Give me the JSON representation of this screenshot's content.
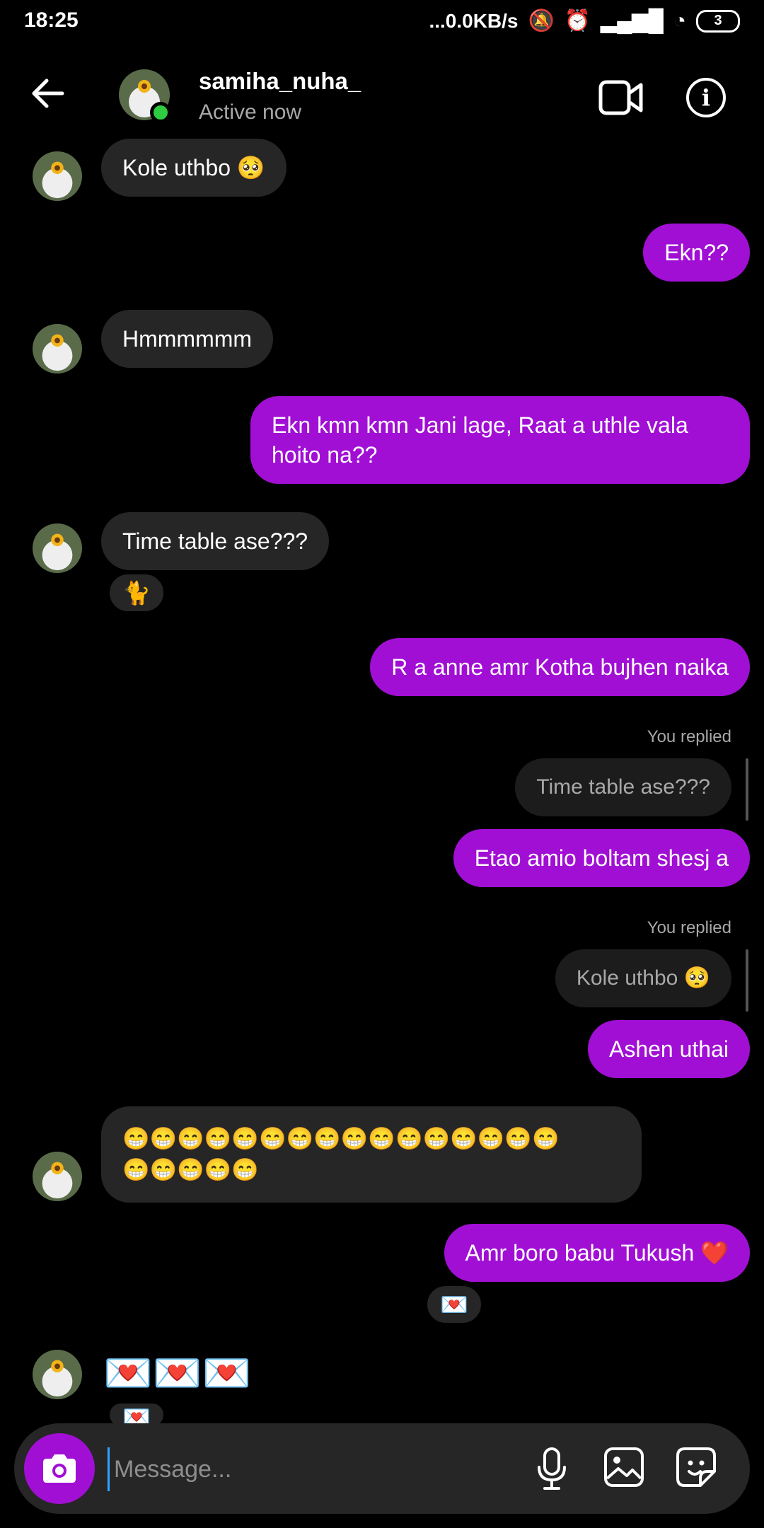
{
  "status_bar": {
    "time": "18:25",
    "network_speed": "...0.0KB/s",
    "battery": "3"
  },
  "header": {
    "username": "samiha_nuha_",
    "status": "Active now"
  },
  "messages": {
    "m1": "Kole uthbo 🥺",
    "m2": "Ekn??",
    "m3": "Hmmmmmm",
    "m4": "Ekn kmn kmn Jani lage, Raat a uthle vala hoito na??",
    "m5": "Time table ase???",
    "m5_reaction": "🐈",
    "m6": "R a anne amr Kotha bujhen naika",
    "reply1_label": "You replied",
    "reply1_quote": "Time table ase???",
    "m7": "Etao amio boltam shesj a",
    "reply2_label": "You replied",
    "reply2_quote": "Kole uthbo 🥺",
    "m8": "Ashen uthai",
    "m9": "😁😁😁😁😁😁😁😁😁😁😁😁😁😁😁😁\n😁😁😁😁😁",
    "m10": "Amr boro babu Tukush ❤️",
    "m10_reaction": "💌",
    "m11": "💌💌💌",
    "m11_reaction": "💌"
  },
  "composer": {
    "placeholder": "Message..."
  },
  "colors": {
    "outgoing_bubble": "#a10fd4",
    "incoming_bubble": "#262626",
    "online": "#2ecc40"
  },
  "icons": [
    "back-arrow-icon",
    "video-call-icon",
    "info-icon",
    "camera-icon",
    "microphone-icon",
    "gallery-icon",
    "sticker-icon"
  ]
}
